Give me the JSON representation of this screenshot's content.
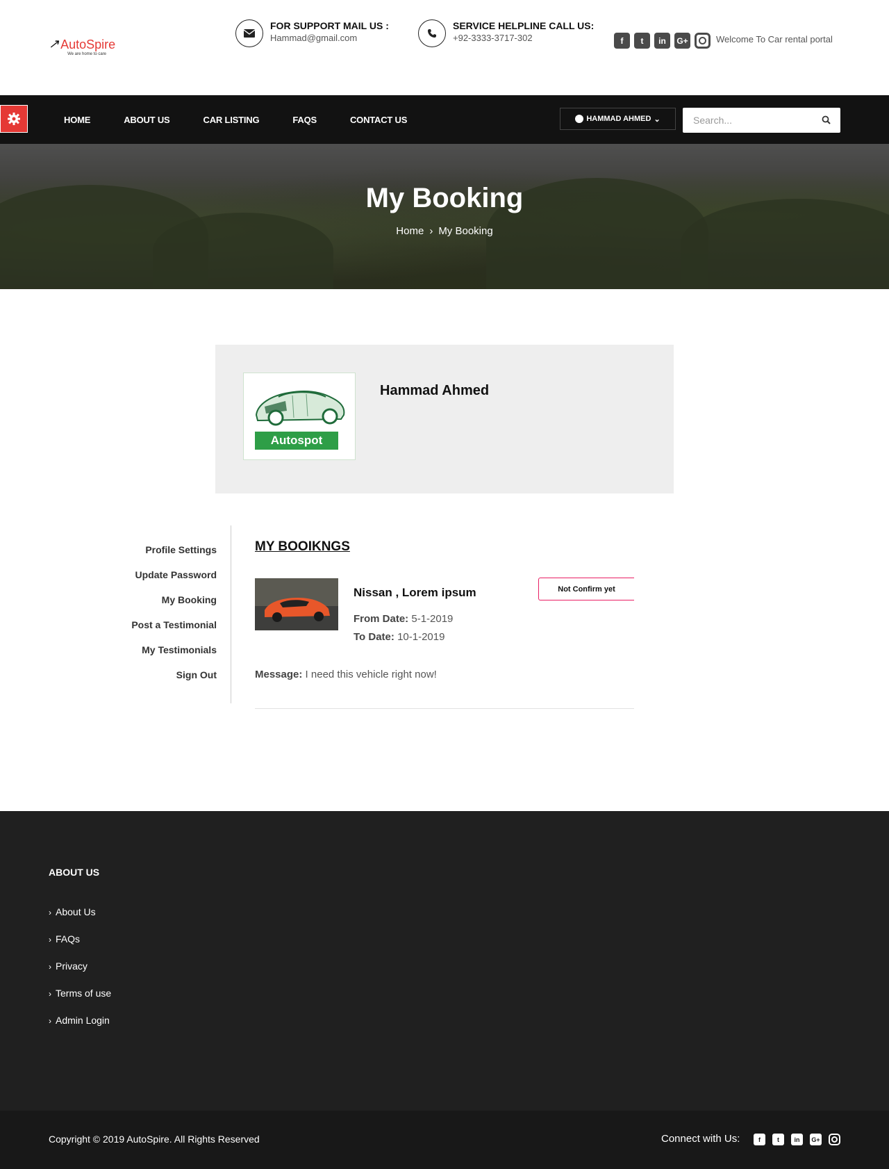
{
  "brand": {
    "name": "AutoSpire",
    "tagline": "We are home to care"
  },
  "header": {
    "support": {
      "title": "FOR SUPPORT MAIL US :",
      "value": "Hammad@gmail.com"
    },
    "helpline": {
      "title": "SERVICE HELPLINE CALL US:",
      "value": "+92-3333-3717-302"
    },
    "social_icons": [
      "facebook-icon",
      "twitter-icon",
      "linkedin-icon",
      "google-plus-icon",
      "instagram-icon"
    ],
    "welcome": "Welcome To Car rental portal"
  },
  "nav": {
    "items": [
      "HOME",
      "ABOUT US",
      "CAR LISTING",
      "FAQS",
      "CONTACT US"
    ],
    "user": "HAMMAD AHMED",
    "search_placeholder": "Search..."
  },
  "banner": {
    "title": "My Booking",
    "breadcrumb": [
      "Home",
      "My Booking"
    ]
  },
  "profile": {
    "name": "Hammad Ahmed",
    "avatar_label": "Autospot"
  },
  "side_menu": [
    "Profile Settings",
    "Update Password",
    "My Booking",
    "Post a Testimonial",
    "My Testimonials",
    "Sign Out"
  ],
  "bookings": {
    "title": "MY BOOIKNGS",
    "items": [
      {
        "car": "Nissan , Lorem ipsum",
        "from_label": "From Date:",
        "from": "5-1-2019",
        "to_label": "To Date:",
        "to": "10-1-2019",
        "status": "Not Confirm yet",
        "message_label": "Message:",
        "message": "I need this vehicle right now!"
      }
    ]
  },
  "footer": {
    "heading": "ABOUT US",
    "links": [
      "About Us",
      "FAQs",
      "Privacy",
      "Terms of use",
      "Admin Login"
    ],
    "copyright": "Copyright © 2019 AutoSpire. All Rights Reserved",
    "connect": "Connect with Us:"
  },
  "colors": {
    "accent": "#e53935",
    "nav_bg": "#121212",
    "footer_bg": "#202020",
    "status_border": "#e91e63",
    "brand_green": "#2e9e47"
  }
}
